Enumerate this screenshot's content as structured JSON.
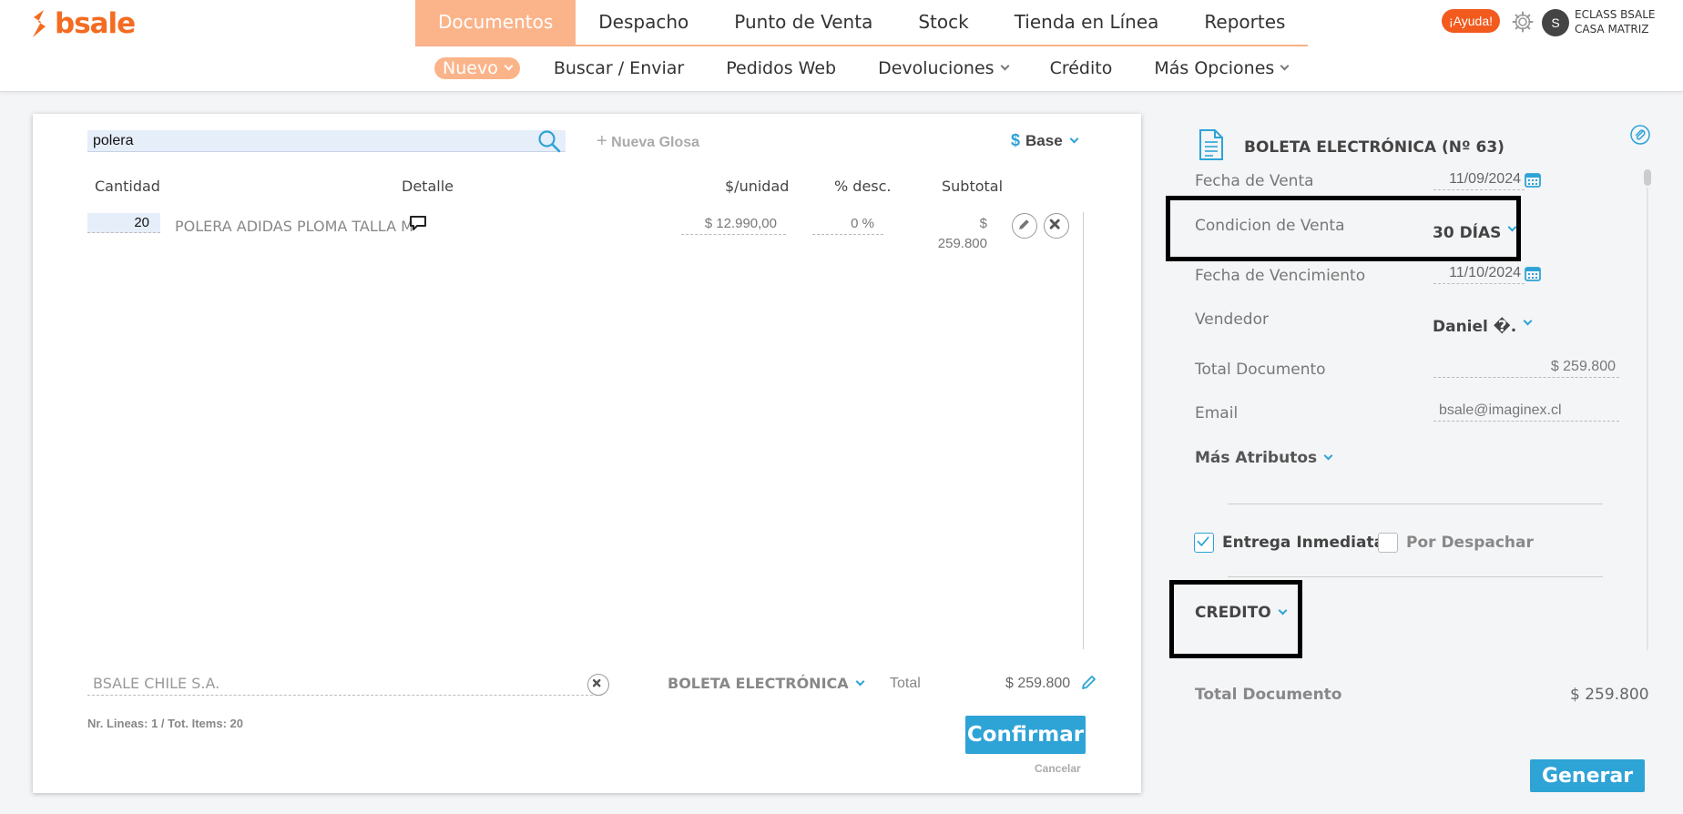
{
  "brand": {
    "name": "bsale"
  },
  "topnav": {
    "items": [
      {
        "label": "Documentos",
        "active": true
      },
      {
        "label": "Despacho",
        "active": false
      },
      {
        "label": "Punto de Venta",
        "active": false
      },
      {
        "label": "Stock",
        "active": false
      },
      {
        "label": "Tienda en Línea",
        "active": false
      },
      {
        "label": "Reportes",
        "active": false
      }
    ],
    "help_label": "¡Ayuda!",
    "user_initial": "S",
    "user_company": "ECLASS BSALE",
    "user_branch": "CASA MATRIZ"
  },
  "subnav": {
    "nuevo": "Nuevo",
    "buscar": "Buscar / Enviar",
    "pedidos": "Pedidos Web",
    "devoluciones": "Devoluciones",
    "credito": "Crédito",
    "mas_opciones": "Más Opciones"
  },
  "editor": {
    "search_value": "polera",
    "new_glosa": "Nueva Glosa",
    "currency_symbol": "$",
    "currency_label": "Base",
    "columns": {
      "cantidad": "Cantidad",
      "detalle": "Detalle",
      "unit_price": "$/unidad",
      "discount": "% desc.",
      "subtotal": "Subtotal"
    },
    "rows": [
      {
        "qty": "20",
        "detail": "POLERA ADIDAS PLOMA TALLA M",
        "unit_price": "$ 12.990,00",
        "discount": "0 %",
        "subtotal": "$ 259.800"
      }
    ],
    "client": "BSALE CHILE S.A.",
    "doc_type": "BOLETA ELECTRÓNICA",
    "total_label": "Total",
    "total_value": "$ 259.800",
    "summary": "Nr. Lineas: 1 / Tot. Items: 20",
    "confirm": "Confirmar",
    "cancel": "Cancelar"
  },
  "sidebar": {
    "doc_title": "BOLETA ELECTRÓNICA (Nº 63)",
    "fecha_venta_label": "Fecha de Venta",
    "fecha_venta": "11/09/2024",
    "condicion_label": "Condicion de Venta",
    "condicion_value": "30 DÍAS",
    "fecha_venc_label": "Fecha de Vencimiento",
    "fecha_venc": "11/10/2024",
    "vendedor_label": "Vendedor",
    "vendedor_value": "Daniel �.",
    "total_doc_label": "Total Documento",
    "total_doc_value": "$ 259.800",
    "email_label": "Email",
    "email_value": "bsale@imaginex.cl",
    "mas_atributos": "Más Atributos",
    "entrega_inmediata": "Entrega Inmediata",
    "entrega_checked": true,
    "por_despachar": "Por Despachar",
    "por_despachar_checked": false,
    "payment_label": "CREDITO",
    "footer_total_label": "Total Documento",
    "footer_total_value": "$ 259.800",
    "generate": "Generar"
  },
  "colors": {
    "accent_orange": "#f46b21",
    "nav_active": "#fbb48a",
    "accent_blue": "#2ea3d6"
  }
}
